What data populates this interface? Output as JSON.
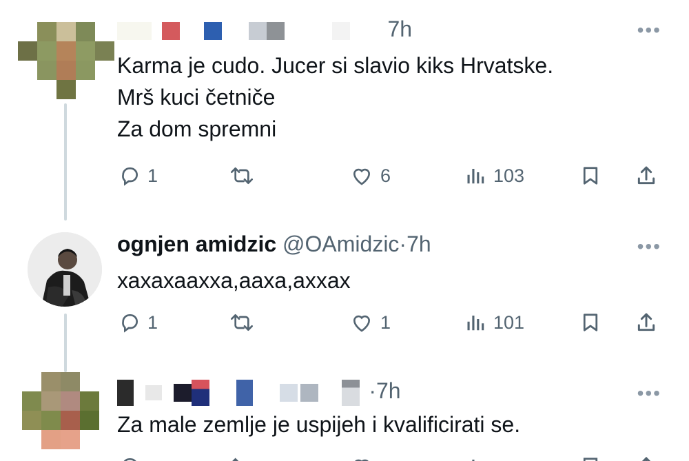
{
  "tweets": [
    {
      "time": "7h",
      "lines": [
        "Karma je cudo. Jucer si slavio kiks Hrvatske.",
        "Mrš kuci četniče",
        "Za dom spremni"
      ],
      "replies": "1",
      "retweets": "",
      "likes": "6",
      "views": "103"
    },
    {
      "name": "ognjen amidzic",
      "handle": "@OAmidzic",
      "sep": "·",
      "time": "7h",
      "lines": [
        "хахахааххa,aaxa,axxax"
      ],
      "replies": "1",
      "retweets": "",
      "likes": "1",
      "views": "101"
    },
    {
      "sep": "·",
      "time": "7h",
      "lines": [
        "Za male zemlje je uspijeh i kvalificirati se."
      ]
    }
  ],
  "more_label": "•••",
  "icons": [
    "reply-icon",
    "retweet-icon",
    "like-icon",
    "views-icon",
    "bookmark-icon",
    "share-icon"
  ]
}
